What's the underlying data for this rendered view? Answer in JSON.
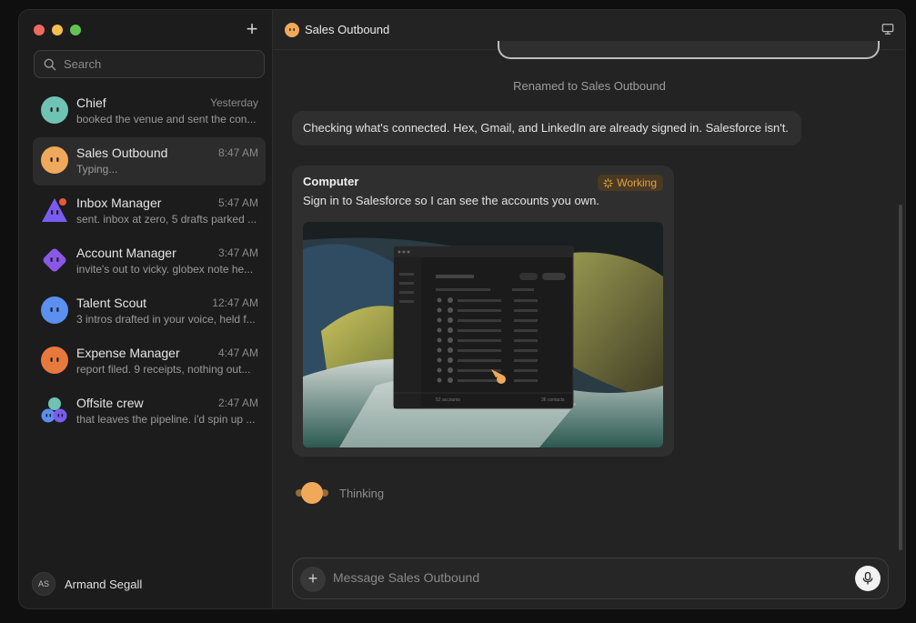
{
  "search": {
    "placeholder": "Search"
  },
  "chats": [
    {
      "name": "Chief",
      "time": "Yesterday",
      "preview": "booked the venue and sent the con...",
      "color": "#6ec3b3",
      "shape": "circle"
    },
    {
      "name": "Sales Outbound",
      "time": "8:47 AM",
      "preview": "Typing...",
      "color": "#f0a95b",
      "shape": "circle",
      "active": true
    },
    {
      "name": "Inbox Manager",
      "time": "5:47 AM",
      "preview": "sent. inbox at zero, 5 drafts parked ...",
      "color": "#7a5cf0",
      "shape": "triangle"
    },
    {
      "name": "Account Manager",
      "time": "3:47 AM",
      "preview": "invite's out to vicky. globex note he...",
      "color": "#8a58e8",
      "shape": "diamond"
    },
    {
      "name": "Talent Scout",
      "time": "12:47 AM",
      "preview": "3 intros drafted in your voice, held f...",
      "color": "#5b8ff0",
      "shape": "circle"
    },
    {
      "name": "Expense Manager",
      "time": "4:47 AM",
      "preview": "report filed. 9 receipts, nothing out...",
      "color": "#e8793c",
      "shape": "circle"
    },
    {
      "name": "Offsite crew",
      "time": "2:47 AM",
      "preview": "that leaves the pipeline. i'd spin up ...",
      "color": "#7a5cf0",
      "shape": "group"
    }
  ],
  "user": {
    "initials": "AS",
    "name": "Armand Segall"
  },
  "header": {
    "title": "Sales Outbound"
  },
  "conversation": {
    "system_note": "Renamed to Sales Outbound",
    "message": "Checking what's connected. Hex, Gmail, and LinkedIn are already signed in. Salesforce isn't.",
    "card": {
      "title": "Computer",
      "status": "Working",
      "text": "Sign in to Salesforce so I can see the accounts you own.",
      "screenshot": {
        "footer_left": "52 accounts",
        "footer_right": "36 contacts"
      }
    },
    "thinking": "Thinking"
  },
  "composer": {
    "placeholder": "Message Sales Outbound"
  }
}
